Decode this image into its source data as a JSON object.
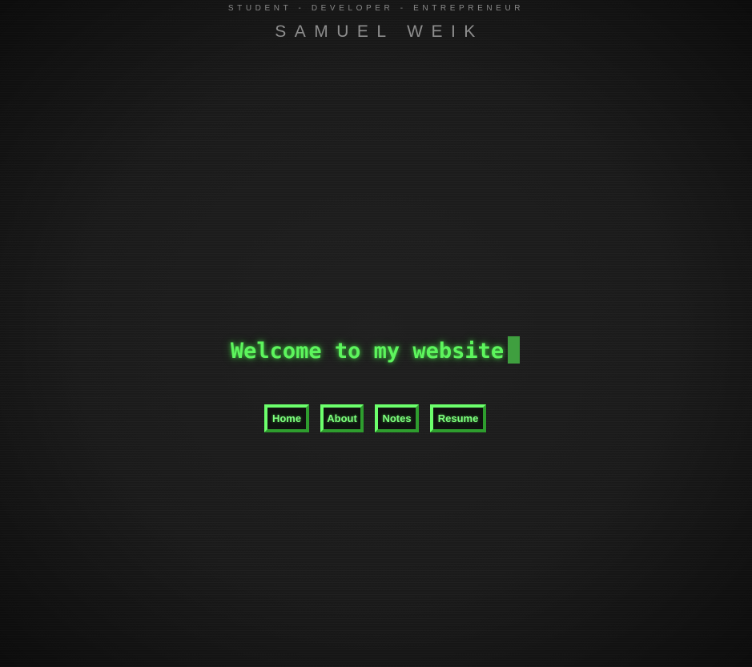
{
  "header": {
    "tagline_parts": [
      "STUDENT",
      "DEVELOPER",
      "ENTREPRENEUR"
    ],
    "tagline_separator": "-",
    "name": "SAMUEL WEIK"
  },
  "hero": {
    "welcome_text": "Welcome to my website"
  },
  "nav": {
    "items": [
      {
        "label": "Home"
      },
      {
        "label": "About"
      },
      {
        "label": "Notes"
      },
      {
        "label": "Resume"
      }
    ]
  },
  "colors": {
    "background": "#1c1c1c",
    "accent_green": "#5df55d",
    "button_border_light": "#6cff6c",
    "button_border_dark": "#2e9d2e",
    "header_text": "#8e8e8e"
  }
}
